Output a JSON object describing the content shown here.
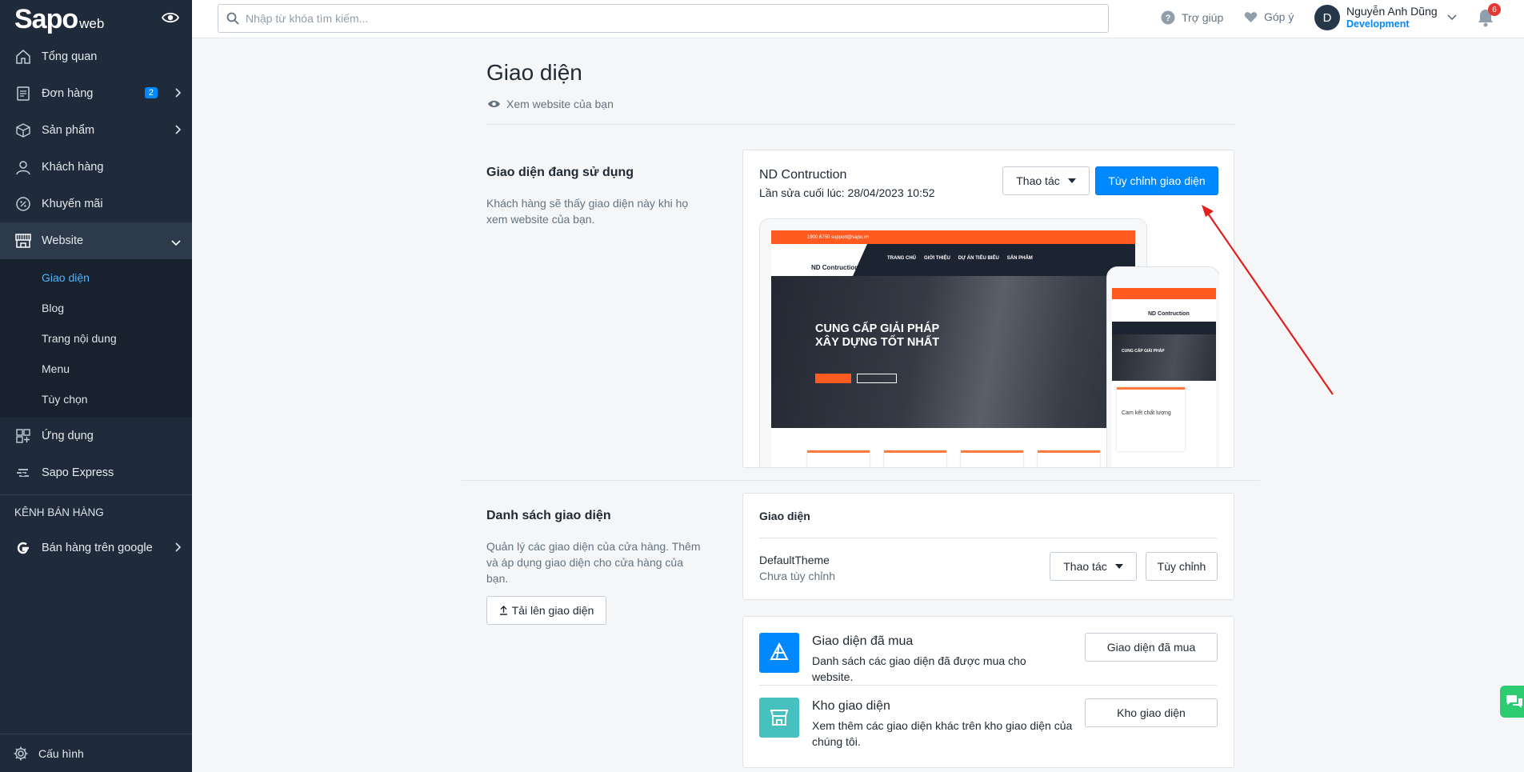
{
  "brand": {
    "logo_main": "Sapo",
    "logo_sub": "web"
  },
  "sidebar": {
    "items": [
      {
        "label": "Tổng quan"
      },
      {
        "label": "Đơn hàng",
        "badge": "2"
      },
      {
        "label": "Sản phẩm"
      },
      {
        "label": "Khách hàng"
      },
      {
        "label": "Khuyến mãi"
      },
      {
        "label": "Website"
      }
    ],
    "website_sub": [
      {
        "label": "Giao diện"
      },
      {
        "label": "Blog"
      },
      {
        "label": "Trang nội dung"
      },
      {
        "label": "Menu"
      },
      {
        "label": "Tùy chọn"
      }
    ],
    "more_items": [
      {
        "label": "Ứng dụng"
      },
      {
        "label": "Sapo Express"
      }
    ],
    "channel_heading": "KÊNH BÁN HÀNG",
    "channel_items": [
      {
        "label": "Bán hàng trên google"
      }
    ],
    "settings_label": "Cấu hình"
  },
  "topbar": {
    "search_placeholder": "Nhập từ khóa tìm kiếm...",
    "help_label": "Trợ giúp",
    "feedback_label": "Góp ý",
    "user_initial": "D",
    "user_name": "Nguyễn Anh Dũng",
    "user_role": "Development",
    "notification_count": "6"
  },
  "page": {
    "title": "Giao diện",
    "view_site_label": "Xem website của bạn"
  },
  "current_theme": {
    "section_title": "Giao diện đang sử dụng",
    "section_desc": "Khách hàng sẽ thấy giao diện này khi họ xem website của bạn.",
    "name": "ND Contruction",
    "last_updated": "Lần sửa cuối lúc: 28/04/2023 10:52",
    "actions_label": "Thao tác",
    "customize_label": "Tùy chỉnh giao diện",
    "preview": {
      "top_contact": "1900 6750   support@sapo.vn",
      "logo": "ND Contruction",
      "menu": [
        "TRANG CHỦ",
        "GIỚI THIỆU",
        "DỰ ÁN TIÊU BIỂU",
        "SẢN PHẨM"
      ],
      "hero_line1": "CUNG CẤP GIẢI PHÁP",
      "hero_line2": "XÂY DỰNG TỐT NHẤT",
      "mobile_logo": "ND Contruction",
      "mobile_card_title": "Cam kết chất lượng"
    }
  },
  "theme_list": {
    "section_title": "Danh sách giao diện",
    "section_desc": "Quản lý các giao diện của cửa hàng. Thêm và áp dụng giao diện cho cửa hàng của bạn.",
    "upload_label": "Tải lên giao diện",
    "table_heading": "Giao diện",
    "rows": [
      {
        "name": "DefaultTheme",
        "status": "Chưa tùy chỉnh",
        "actions_label": "Thao tác",
        "customize_label": "Tùy chỉnh"
      }
    ]
  },
  "features": [
    {
      "title": "Giao diện đã mua",
      "desc": "Danh sách các giao diện đã được mua cho website.",
      "button": "Giao diện đã mua",
      "color": "#0088ff"
    },
    {
      "title": "Kho giao diện",
      "desc": "Xem thêm các giao diện khác trên kho giao diện của chúng tôi.",
      "button": "Kho giao diện",
      "color": "#47c1bf"
    }
  ],
  "colors": {
    "sidebar_bg": "#1f2b3a",
    "accent": "#0088ff",
    "active_sub": "#4eb5ff",
    "arrow": "#e0201c"
  }
}
